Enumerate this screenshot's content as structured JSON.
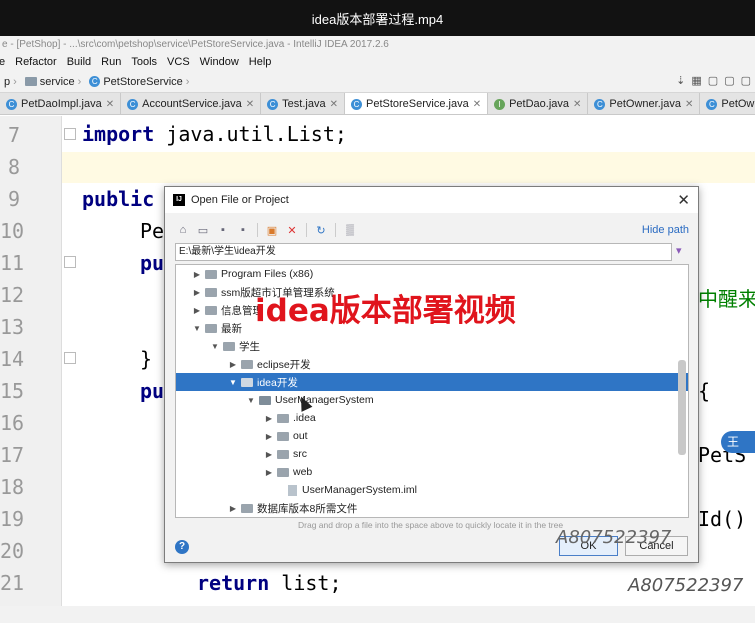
{
  "video": {
    "title": "idea版本部署过程.mp4"
  },
  "ide": {
    "window_title": "e - [PetShop] - ...\\src\\com\\petshop\\service\\PetStoreService.java - IntelliJ IDEA 2017.2.6",
    "menu": [
      "e",
      "Refactor",
      "Build",
      "Run",
      "Tools",
      "VCS",
      "Window",
      "Help"
    ],
    "breadcrumbs": [
      "p",
      "service",
      "PetStoreService"
    ],
    "tabs": [
      {
        "label": "PetDaoImpl.java",
        "icon": "class-icon",
        "active": false
      },
      {
        "label": "AccountService.java",
        "icon": "class-icon",
        "active": false
      },
      {
        "label": "Test.java",
        "icon": "class-icon",
        "active": false
      },
      {
        "label": "PetStoreService.java",
        "icon": "class-icon",
        "active": true
      },
      {
        "label": "PetDao.java",
        "icon": "interface-icon",
        "active": false
      },
      {
        "label": "PetOwner.java",
        "icon": "class-icon",
        "active": false
      },
      {
        "label": "PetOwnerD",
        "icon": "class-icon",
        "active": false
      }
    ]
  },
  "editor": {
    "line_numbers": [
      "7",
      "8",
      "9",
      "10",
      "11",
      "12",
      "13",
      "14",
      "15",
      "16",
      "17",
      "18",
      "19",
      "20",
      "21"
    ],
    "code": {
      "l7_kw": "import",
      "l7_rest": " java.util.List;",
      "l9_kw": "public",
      "l10": "Pe",
      "l11": "pu",
      "l12_green": "中醒来",
      "l14": "}",
      "l15": "pu",
      "l15_right": "{",
      "l17_right": "PetS",
      "l19_right": "Id()",
      "l21_kw": "return",
      "l21_rest": " list;"
    }
  },
  "dialog": {
    "title": "Open File or Project",
    "hide_path": "Hide path",
    "path": "E:\\最新\\学生\\idea开发",
    "tree": [
      {
        "label": "Program Files (x86)",
        "arrow": "▶"
      },
      {
        "label": "ssm版超市订单管理系统",
        "arrow": "▶"
      },
      {
        "label": "信息管理",
        "arrow": "▶"
      },
      {
        "label": "最新",
        "arrow": "▼"
      },
      {
        "label": "学生",
        "arrow": "▼"
      },
      {
        "label": "eclipse开发",
        "arrow": "▶"
      },
      {
        "label": "idea开发",
        "arrow": "▼",
        "selected": true
      },
      {
        "label": "UserManagerSystem",
        "arrow": "▼"
      },
      {
        "label": ".idea",
        "arrow": "▶"
      },
      {
        "label": "out",
        "arrow": "▶"
      },
      {
        "label": "src",
        "arrow": "▶"
      },
      {
        "label": "web",
        "arrow": "▶"
      },
      {
        "label": "UserManagerSystem.iml",
        "arrow": ""
      },
      {
        "label": "数据库版本8所需文件",
        "arrow": "▶"
      },
      {
        "label": "...",
        "arrow": "▶"
      }
    ],
    "drag_hint": "Drag and drop a file into the space above to quickly locate it in the tree",
    "ok": "OK",
    "cancel": "Cancel",
    "help": "?"
  },
  "overlay": {
    "caption": "idea版本部署视频",
    "watermark": "A807522397",
    "side_badge": "王"
  },
  "colors": {
    "selection": "#2f75c5",
    "caption_red": "#e0141c",
    "keyword": "#000080"
  }
}
